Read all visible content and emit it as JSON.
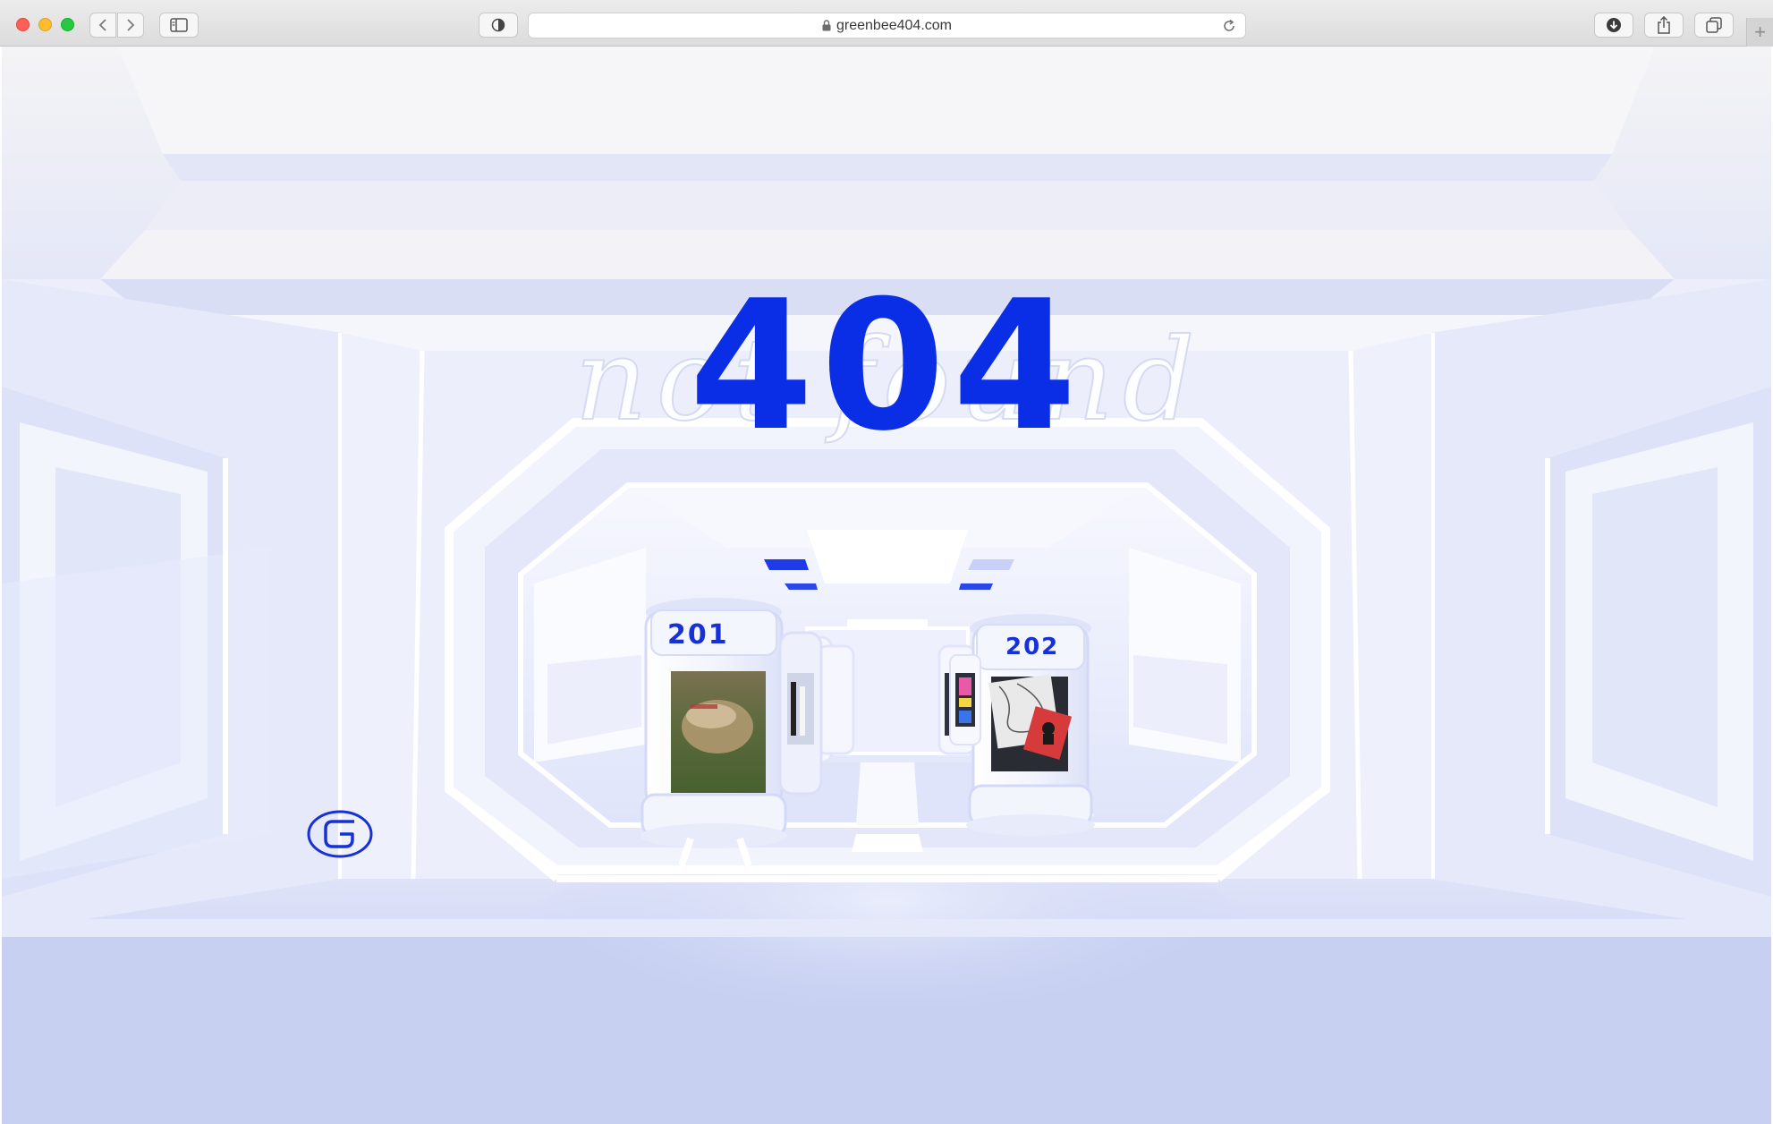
{
  "browser": {
    "url": "greenbee404.com",
    "new_tab_label": "+",
    "icons": {
      "back": "chevron-left-icon",
      "forward": "chevron-right-icon",
      "sidebar": "sidebar-icon",
      "privacy": "privacy-shield-icon",
      "lock": "lock-icon",
      "reload": "reload-icon",
      "downloads": "download-icon",
      "share": "share-icon",
      "tabs": "tab-overview-icon"
    }
  },
  "page": {
    "error_code": "404",
    "error_script": "not found",
    "pods": [
      {
        "label": "201"
      },
      {
        "label": "202"
      }
    ],
    "brand_logo": "G",
    "colors": {
      "accent": "#0a2ee6",
      "corridor": "#e9ecfb",
      "floor": "#c9d1f3"
    }
  }
}
